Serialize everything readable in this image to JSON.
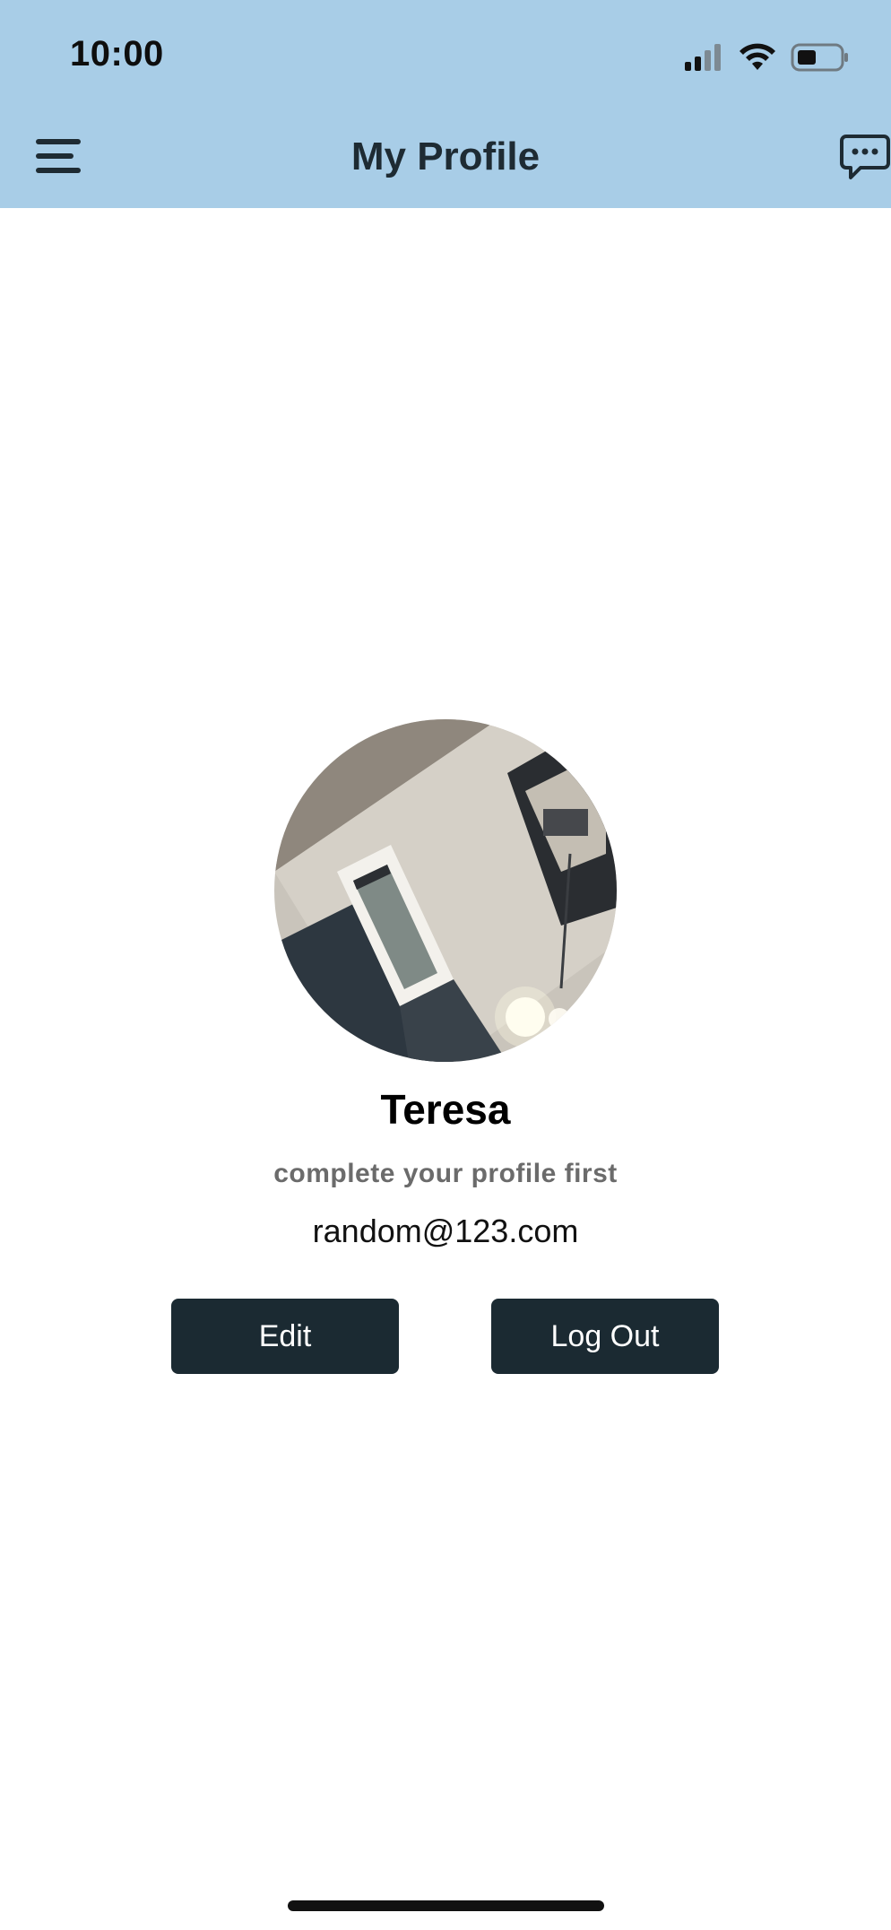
{
  "status_bar": {
    "time": "10:00",
    "icons": [
      "signal-icon",
      "wifi-icon",
      "battery-icon"
    ]
  },
  "nav": {
    "title": "My Profile",
    "left_icon": "menu-icon",
    "right_icon": "chat-icon"
  },
  "profile": {
    "name": "Teresa",
    "hint": "complete your profile first",
    "email": "random@123.com"
  },
  "actions": {
    "edit_label": "Edit",
    "logout_label": "Log Out"
  },
  "colors": {
    "header_bg": "#a8cde7",
    "button_bg": "#1b2a32",
    "button_text": "#ffffff",
    "title_text": "#1e2b33",
    "hint_text": "#6b6b6b"
  }
}
